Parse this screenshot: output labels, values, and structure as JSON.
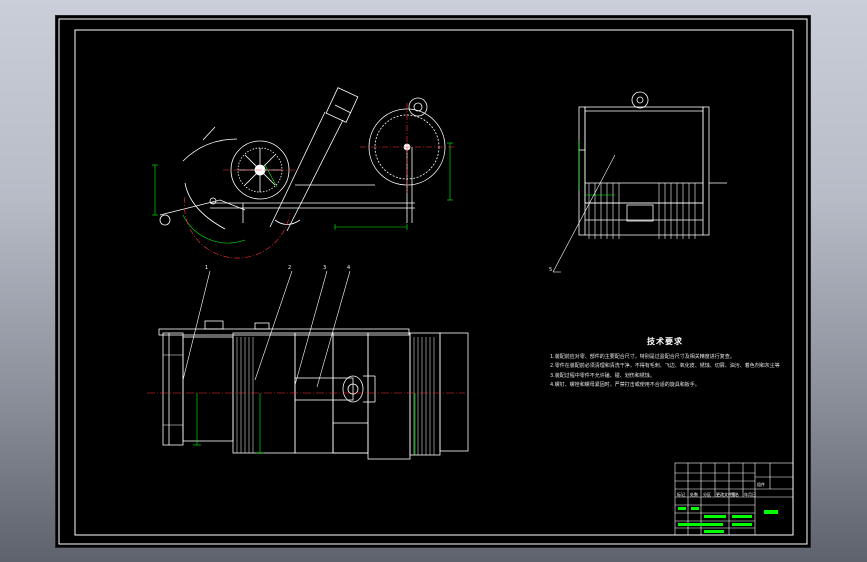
{
  "sheet": {
    "background": "#000000",
    "line_color": "#ffffff",
    "dim_color": "#00ff00",
    "centerline_color": "#ff3030"
  },
  "tech_requirements": {
    "title": "技术要求",
    "items": [
      "1.装配前应对零、部件的主要配合尺寸，特别是过盈配合尺寸及相关精度进行复查。",
      "2.零件在装配前必须清理和清洗干净，不得有毛刺、飞边、氧化皮、锈蚀、切屑、油污、着色剂和灰尘等。",
      "3.装配过程中零件不允许磕、碰、划伤和锈蚀。",
      "4.螺钉、螺栓和螺母紧固时，严禁打击或使用不合适的旋具和扳手。"
    ]
  },
  "title_block": {
    "name_cell": "组件",
    "header_labels": [
      "标记",
      "处数",
      "分区",
      "更改文件号",
      "签名",
      "年月日"
    ]
  },
  "balloons": [
    "1",
    "2",
    "3",
    "4",
    "5"
  ]
}
